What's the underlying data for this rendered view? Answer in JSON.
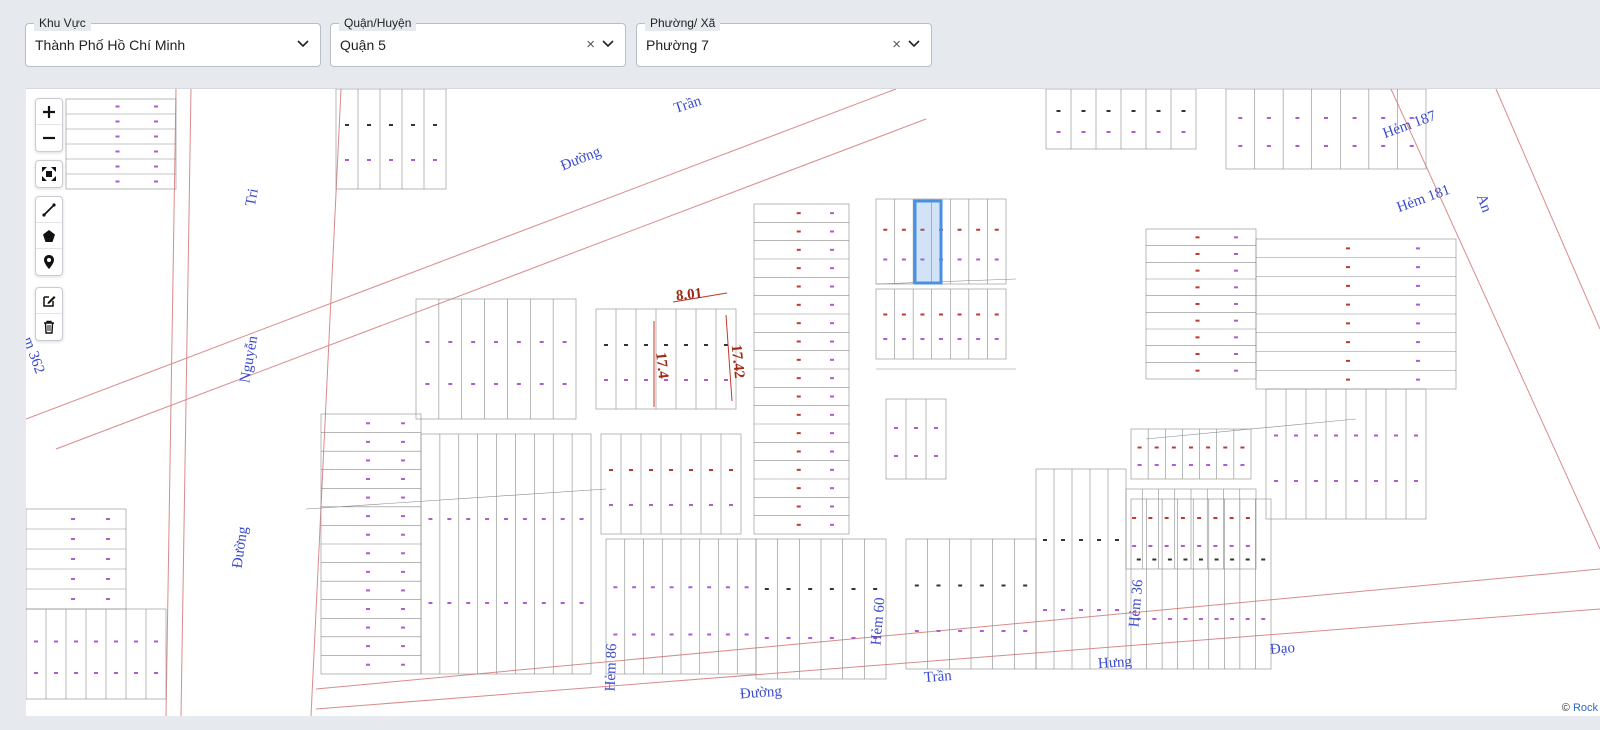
{
  "filters": {
    "region": {
      "label": "Khu Vực",
      "value": "Thành Phố Hồ Chí Minh"
    },
    "district": {
      "label": "Quận/Huyện",
      "value": "Quận 5",
      "clear_icon": "×"
    },
    "ward": {
      "label": "Phường/ Xã",
      "value": "Phường 7",
      "clear_icon": "×"
    }
  },
  "map": {
    "streets": {
      "tran_1": "Trần",
      "duong_1": "Đường",
      "tri": "Tri",
      "nguyen": "Nguyễn",
      "hem362": "m 362",
      "duong_2": "Đường",
      "hem187": "Hẻm 187",
      "hem181": "Hẻm 181",
      "an": "An",
      "hem86": "Hẻm 86",
      "hem60": "Hẻm 60",
      "hem36": "Hẻm 36",
      "duong_3": "Đường",
      "tran_2": "Trần",
      "hung": "Hưng",
      "dao": "Đạo"
    },
    "dimensions": {
      "width": "8.01",
      "depth1": "17.4",
      "depth2": "17.42"
    },
    "selected_parcel_color": "#4a90e2",
    "line_color": "#8a8a8a",
    "road_color": "#d98b8b",
    "attribution": {
      "prefix": "©",
      "link": "Rock"
    }
  },
  "toolbar": {
    "zoom_in": "zoom-in-icon",
    "zoom_out": "zoom-out-icon",
    "fullscreen": "fullscreen-icon",
    "draw_line": "line-icon",
    "draw_polygon": "polygon-icon",
    "draw_marker": "marker-icon",
    "edit": "edit-icon",
    "delete": "trash-icon"
  }
}
